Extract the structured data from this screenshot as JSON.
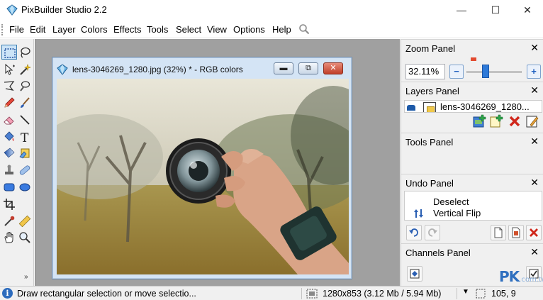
{
  "window": {
    "title": "PixBuilder Studio 2.2",
    "controls": {
      "minimize": "—",
      "maximize": "☐",
      "close": "✕"
    }
  },
  "menu": {
    "items": [
      "File",
      "Edit",
      "Layer",
      "Colors",
      "Effects",
      "Tools",
      "Select",
      "View",
      "Options",
      "Help"
    ]
  },
  "toolbox": {
    "tools": [
      "rectangular-selection",
      "lasso",
      "move",
      "magic-wand",
      "polygonal-lasso",
      "lasso-brush",
      "pencil",
      "brush",
      "eraser",
      "line",
      "paint-bucket",
      "text",
      "gradient",
      "color-fill",
      "clone-stamp",
      "healing",
      "rectangle-shape",
      "ellipse-shape",
      "crop",
      "eyedropper",
      "measure",
      "hand",
      "zoom"
    ],
    "more": "»"
  },
  "document": {
    "title": "lens-3046269_1280.jpg (32%) * - RGB colors",
    "buttons": {
      "minimize": "▬",
      "restore": "⧉",
      "close": "✕"
    }
  },
  "panels": {
    "zoom": {
      "title": "Zoom Panel",
      "value": "32.11%",
      "minus": "−",
      "plus": "+",
      "slider_level": 0.33
    },
    "layers": {
      "title": "Layers Panel",
      "layer_name": "lens-3046269_1280..."
    },
    "tools": {
      "title": "Tools Panel"
    },
    "undo": {
      "title": "Undo Panel",
      "items": [
        "Deselect",
        "Vertical Flip"
      ]
    },
    "channels": {
      "title": "Channels Panel"
    },
    "close_glyph": "✕"
  },
  "status": {
    "info_glyph": "i",
    "text": "Draw rectangular selection or move selectio...",
    "dimensions": "1280x853  (3.12 Mb / 5.94 Mb)",
    "coords": "105, 9"
  },
  "watermark": {
    "brand": "PK",
    "suffix": ".com.tw"
  },
  "colors": {
    "accent": "#2f7ad8",
    "close_red": "#c0402a",
    "workspace": "#a0a0a0"
  }
}
